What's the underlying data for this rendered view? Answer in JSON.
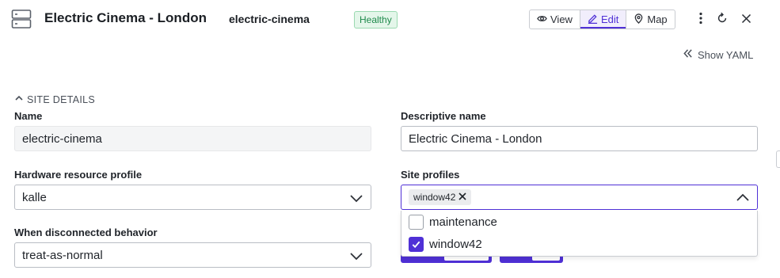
{
  "header": {
    "title": "Electric Cinema - London",
    "subtitle": "electric-cinema",
    "status_badge": "Healthy",
    "view_modes": [
      {
        "label": "View",
        "icon": "eye-icon",
        "active": false
      },
      {
        "label": "Edit",
        "icon": "pencil-icon",
        "active": true
      },
      {
        "label": "Map",
        "icon": "map-pin-icon",
        "active": false
      }
    ],
    "actions": [
      "more-vertical-icon",
      "refresh-icon",
      "close-icon"
    ]
  },
  "toolbar": {
    "show_yaml_label": "Show YAML"
  },
  "section": {
    "label": "SITE DETAILS",
    "expanded": true
  },
  "form": {
    "name": {
      "label": "Name",
      "value": "electric-cinema"
    },
    "descriptive_name": {
      "label": "Descriptive name",
      "value": "Electric Cinema - London"
    },
    "hardware_profile": {
      "label": "Hardware resource profile",
      "value": "kalle"
    },
    "site_profiles": {
      "label": "Site profiles",
      "selected_tags": [
        "window42"
      ],
      "options": [
        {
          "label": "maintenance",
          "checked": false
        },
        {
          "label": "window42",
          "checked": true
        }
      ]
    },
    "disconnected_behavior": {
      "label": "When disconnected behavior",
      "value": "treat-as-normal"
    }
  },
  "colors": {
    "accent": "#4f30d6",
    "healthy_bg": "#e4f6ea",
    "healthy_text": "#1f8a4c"
  }
}
